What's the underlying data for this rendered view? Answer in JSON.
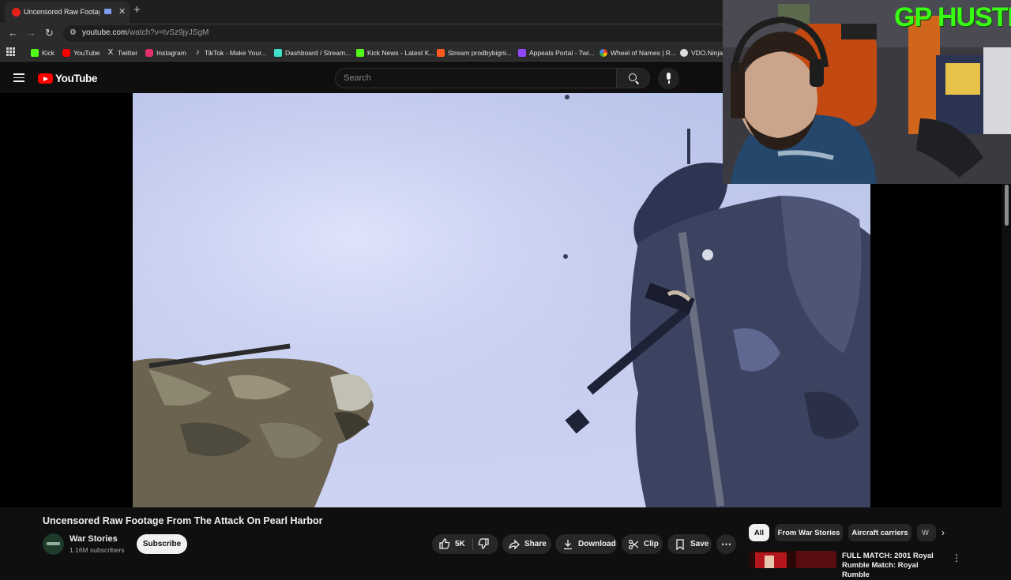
{
  "browser": {
    "tab_title": "Uncensored Raw Footage From The Attack On Pearl Harbor",
    "new_tab_glyph": "+",
    "close_glyph": "✕",
    "url_domain": "youtube.com",
    "url_path": "/watch?v=tvSz9jyJSgM",
    "bookmarks": [
      {
        "label": "Kick",
        "color": "#53fc18"
      },
      {
        "label": "YouTube",
        "color": "#ff0000"
      },
      {
        "label": "Twitter",
        "color": "#e7e9ea"
      },
      {
        "label": "Instagram",
        "color": "#e1306c"
      },
      {
        "label": "TikTok - Make Your...",
        "color": "#e8e8e8"
      },
      {
        "label": "Dashboard / Stream...",
        "color": "#3ee0c7"
      },
      {
        "label": "Kick News - Latest K...",
        "color": "#53fc18"
      },
      {
        "label": "Stream prodbybigni...",
        "color": "#ff5a1f"
      },
      {
        "label": "Appeals Portal - Twi...",
        "color": "#9146ff"
      },
      {
        "label": "Wheel of Names | R...",
        "color": "#f4b400"
      },
      {
        "label": "VDO.Ninja",
        "color": "#dddddd"
      }
    ]
  },
  "youtube": {
    "logo_text": "YouTube",
    "search_placeholder": "Search",
    "video_title": "Uncensored Raw Footage From The Attack On Pearl Harbor",
    "channel_name": "War Stories",
    "subscriber_count": "1.16M subscribers",
    "subscribe_label": "Subscribe",
    "like_count": "5K",
    "actions": {
      "share": "Share",
      "download": "Download",
      "clip": "Clip",
      "save": "Save"
    },
    "chips": [
      "All",
      "From War Stories",
      "Aircraft carriers",
      "W"
    ],
    "recommended": [
      {
        "title": "FULL MATCH: 2001 Royal Rumble Match: Royal Rumble"
      }
    ]
  },
  "stream_overlay": {
    "label": "GP HUSTLA",
    "label_color": "#39ff14"
  }
}
